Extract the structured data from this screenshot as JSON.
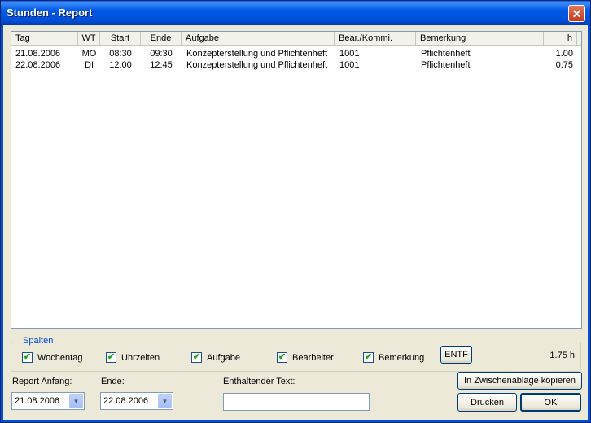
{
  "window": {
    "title": "Stunden - Report"
  },
  "list": {
    "columns": [
      "Tag",
      "WT",
      "Start",
      "Ende",
      "Aufgabe",
      "Bear./Kommi.",
      "Bemerkung",
      "h"
    ],
    "rows": [
      [
        "21.08.2006",
        "MO",
        "08:30",
        "09:30",
        "Konzepterstellung und Pflichtenheft",
        "1001",
        "Pflichtenheft",
        "1.00"
      ],
      [
        "22.08.2006",
        "DI",
        "12:00",
        "12:45",
        "Konzepterstellung und Pflichtenheft",
        "1001",
        "Pflichtenheft",
        "0.75"
      ]
    ]
  },
  "spalten": {
    "legend": "Spalten",
    "checkboxes": [
      {
        "label": "Wochentag",
        "checked": true
      },
      {
        "label": "Uhrzeiten",
        "checked": true
      },
      {
        "label": "Aufgabe",
        "checked": true
      },
      {
        "label": "Bearbeiter",
        "checked": true
      },
      {
        "label": "Bemerkung",
        "checked": true
      }
    ],
    "entf_label": "ENTF",
    "total": "1.75 h"
  },
  "filters": {
    "start_label": "Report Anfang:",
    "start_value": "21.08.2006",
    "end_label": "Ende:",
    "end_value": "22.08.2006",
    "text_label": "Enthaltender Text:",
    "text_value": ""
  },
  "buttons": {
    "clipboard": "In Zwischenablage kopieren",
    "print": "Drucken",
    "ok": "OK"
  }
}
